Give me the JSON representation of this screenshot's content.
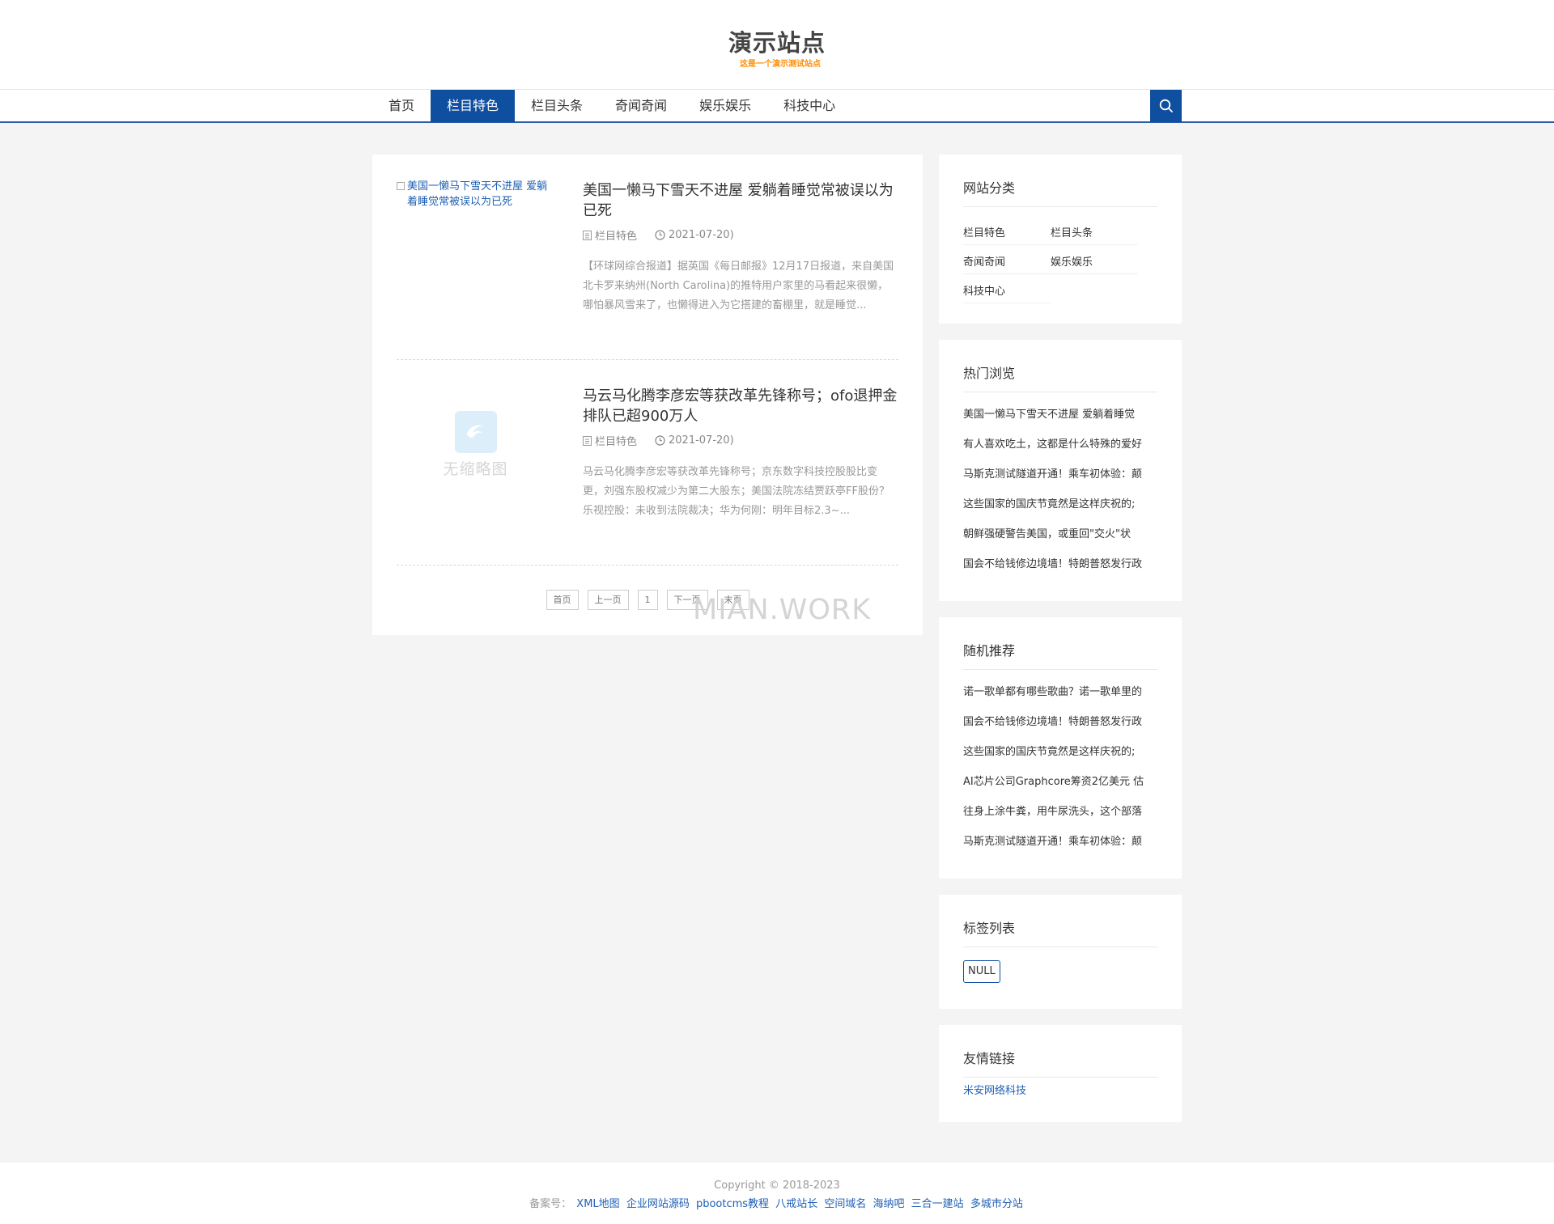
{
  "site": {
    "title": "演示站点",
    "subtitle": "这是一个演示测试站点"
  },
  "nav": {
    "items": [
      "首页",
      "栏目特色",
      "栏目头条",
      "奇闻奇闻",
      "娱乐娱乐",
      "科技中心"
    ],
    "active": "栏目特色",
    "search_icon": "search-icon"
  },
  "articles": [
    {
      "thumb_alt": "美国一懒马下雪天不进屋 爱躺着睡觉常被误以为已死",
      "title": "美国一懒马下雪天不进屋 爱躺着睡觉常被误以为已死",
      "category": "栏目特色",
      "date": "2021-07-20)",
      "excerpt": "【环球网综合报道】据英国《每日邮报》12月17日报道，来自美国北卡罗来纳州(North Carolina)的推特用户家里的马看起来很懒，哪怕暴风雪来了，也懒得进入为它搭建的畜棚里，就是睡觉..."
    },
    {
      "thumb_text": "无缩略图",
      "title": "马云马化腾李彦宏等获改革先锋称号；ofo退押金排队已超900万人",
      "category": "栏目特色",
      "date": "2021-07-20)",
      "excerpt": "马云马化腾李彦宏等获改革先锋称号；京东数字科技控股股比变更，刘强东股权减少为第二大股东；美国法院冻结贾跃亭FF股份？乐视控股：未收到法院裁决；华为何刚：明年目标2.3~..."
    }
  ],
  "pager": [
    "首页",
    "上一页",
    "1",
    "下一页",
    "末页"
  ],
  "watermark": "MIAN.WORK",
  "sidebar": {
    "categories": {
      "title": "网站分类",
      "items": [
        "栏目特色",
        "栏目头条",
        "奇闻奇闻",
        "娱乐娱乐",
        "科技中心"
      ]
    },
    "hot": {
      "title": "热门浏览",
      "items": [
        "美国一懒马下雪天不进屋 爱躺着睡觉",
        "有人喜欢吃土，这都是什么特殊的爱好",
        "马斯克测试隧道开通！乘车初体验：颠",
        "这些国家的国庆节竟然是这样庆祝的;",
        "朝鲜强硬警告美国，或重回\"交火\"状",
        "国会不给钱修边境墙！特朗普怒发行政"
      ]
    },
    "random": {
      "title": "随机推荐",
      "items": [
        "诺一歌单都有哪些歌曲？诺一歌单里的",
        "国会不给钱修边境墙！特朗普怒发行政",
        "这些国家的国庆节竟然是这样庆祝的;",
        "AI芯片公司Graphcore筹资2亿美元 估",
        "往身上涂牛粪，用牛尿洗头，这个部落",
        "马斯克测试隧道开通！乘车初体验：颠"
      ]
    },
    "tags": {
      "title": "标签列表",
      "items": [
        "NULL"
      ]
    },
    "links": {
      "title": "友情链接",
      "items": [
        "米安网络科技"
      ]
    }
  },
  "footer": {
    "copyright": "Copyright © 2018-2023",
    "beian_label": "备案号：",
    "links": [
      "XML地图",
      "企业网站源码",
      "pbootcms教程",
      "八戒站长",
      "空间域名",
      "海纳吧",
      "三合一建站",
      "多城市分站"
    ]
  },
  "colors": {
    "accent": "#0f4fa0",
    "subtitle": "#ff8c00",
    "link": "#1e5fb4",
    "background": "#f4f4f4"
  }
}
